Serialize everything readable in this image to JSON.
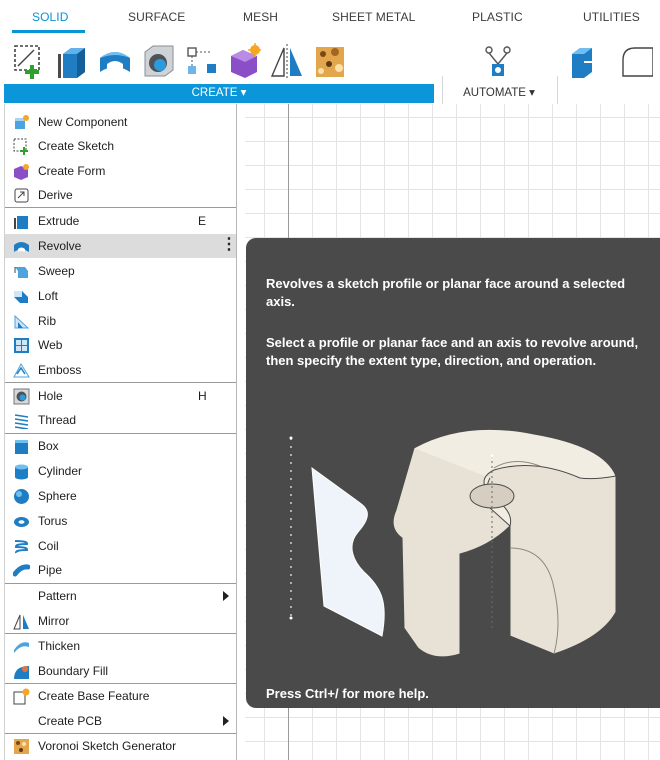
{
  "tabs": [
    {
      "label": "SOLID",
      "active": true
    },
    {
      "label": "SURFACE"
    },
    {
      "label": "MESH"
    },
    {
      "label": "SHEET METAL"
    },
    {
      "label": "PLASTIC"
    },
    {
      "label": "UTILITIES"
    }
  ],
  "toolbar": {
    "tools": [
      {
        "icon": "create-sketch-icon"
      },
      {
        "icon": "extrude-icon"
      },
      {
        "icon": "revolve-icon"
      },
      {
        "icon": "hole-icon"
      },
      {
        "icon": "pattern-icon"
      },
      {
        "icon": "create-form-icon"
      },
      {
        "icon": "mirror-icon"
      },
      {
        "icon": "voronoi-icon"
      },
      {
        "icon": "automate-icon"
      },
      {
        "icon": "modify-press-pull-icon"
      },
      {
        "icon": "fillet-icon"
      }
    ],
    "create_label": "CREATE ▾",
    "automate_label": "AUTOMATE ▾"
  },
  "menu": {
    "items": [
      {
        "label": "New Component",
        "icon": "new-component-icon"
      },
      {
        "label": "Create Sketch",
        "icon": "create-sketch-icon"
      },
      {
        "label": "Create Form",
        "icon": "create-form-icon"
      },
      {
        "label": "Derive",
        "icon": "derive-icon"
      },
      {
        "label": "Extrude",
        "icon": "extrude-icon",
        "shortcut": "E"
      },
      {
        "label": "Revolve",
        "icon": "revolve-icon",
        "highlighted": true
      },
      {
        "label": "Sweep",
        "icon": "sweep-icon"
      },
      {
        "label": "Loft",
        "icon": "loft-icon"
      },
      {
        "label": "Rib",
        "icon": "rib-icon"
      },
      {
        "label": "Web",
        "icon": "web-icon"
      },
      {
        "label": "Emboss",
        "icon": "emboss-icon"
      },
      {
        "label": "Hole",
        "icon": "hole-icon",
        "shortcut": "H"
      },
      {
        "label": "Thread",
        "icon": "thread-icon"
      },
      {
        "label": "Box",
        "icon": "box-icon"
      },
      {
        "label": "Cylinder",
        "icon": "cylinder-icon"
      },
      {
        "label": "Sphere",
        "icon": "sphere-icon"
      },
      {
        "label": "Torus",
        "icon": "torus-icon"
      },
      {
        "label": "Coil",
        "icon": "coil-icon"
      },
      {
        "label": "Pipe",
        "icon": "pipe-icon"
      },
      {
        "label": "Pattern",
        "submenu": true
      },
      {
        "label": "Mirror",
        "icon": "mirror-icon"
      },
      {
        "label": "Thicken",
        "icon": "thicken-icon"
      },
      {
        "label": "Boundary Fill",
        "icon": "boundary-fill-icon"
      },
      {
        "label": "Create Base Feature",
        "icon": "base-feature-icon"
      },
      {
        "label": "Create PCB",
        "submenu": true
      },
      {
        "label": "Voronoi Sketch Generator",
        "icon": "voronoi-icon"
      }
    ]
  },
  "tooltip": {
    "description": "Revolves a sketch profile or planar face around a selected axis.",
    "instructions": "Select a profile or planar face and an axis to revolve around, then specify the extent type, direction, and operation.",
    "help": "Press Ctrl+/ for more help."
  },
  "colors": {
    "accent": "#0696d7",
    "create_bar": "#0a96d8",
    "tooltip_bg": "#4a4a4a",
    "menu_highlight": "#dcdcdc"
  }
}
